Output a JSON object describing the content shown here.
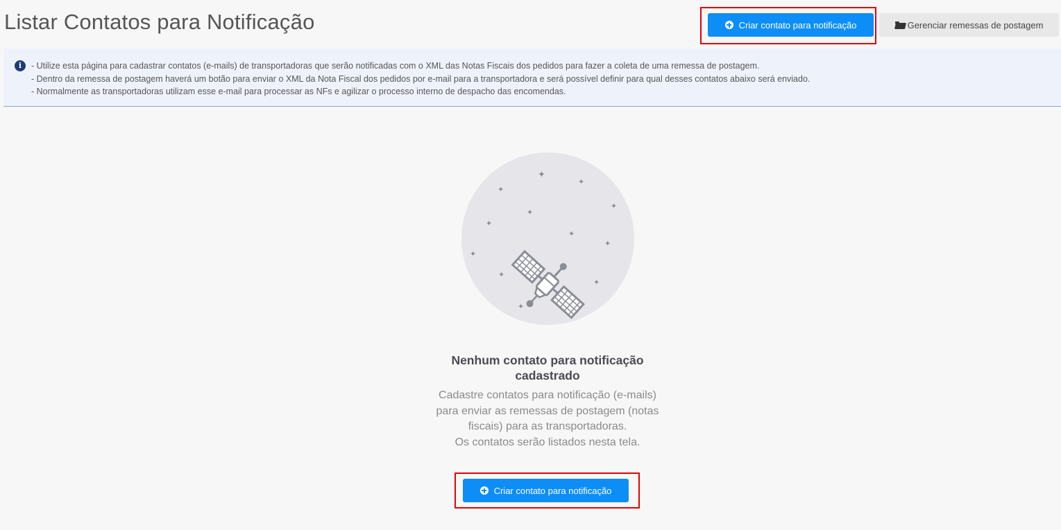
{
  "header": {
    "title": "Listar Contatos para Notificação",
    "create_button_label": "Criar contato para notificação",
    "manage_button_label": "Gerenciar remessas de postagem"
  },
  "info": {
    "lines": [
      "- Utilize esta página para cadastrar contatos (e-mails) de transportadoras que serão notificadas com o XML das Notas Fiscais dos pedidos para fazer a coleta de uma remessa de postagem.",
      "- Dentro da remessa de postagem haverá um botão para enviar o XML da Nota Fiscal dos pedidos por e-mail para a transportadora e será possível definir para qual desses contatos abaixo será enviado.",
      "- Normalmente as transportadoras utilizam esse e-mail para processar as NFs e agilizar o processo interno de despacho das encomendas."
    ]
  },
  "empty_state": {
    "title": "Nenhum contato para notificação cadastrado",
    "description_1": "Cadastre contatos para notificação (e-mails) para enviar as remessas de postagem (notas fiscais) para as transportadoras.",
    "description_2": "Os contatos serão listados nesta tela.",
    "create_button_label": "Criar contato para notificação"
  },
  "icons": {
    "create": "plus-circle-icon",
    "manage": "folder-open-icon",
    "info": "info-circle-icon",
    "illustration": "satellite-icon"
  },
  "colors": {
    "primary": "#0d8ef7",
    "highlight": "#e60000",
    "info_bg": "#eef3fb"
  }
}
